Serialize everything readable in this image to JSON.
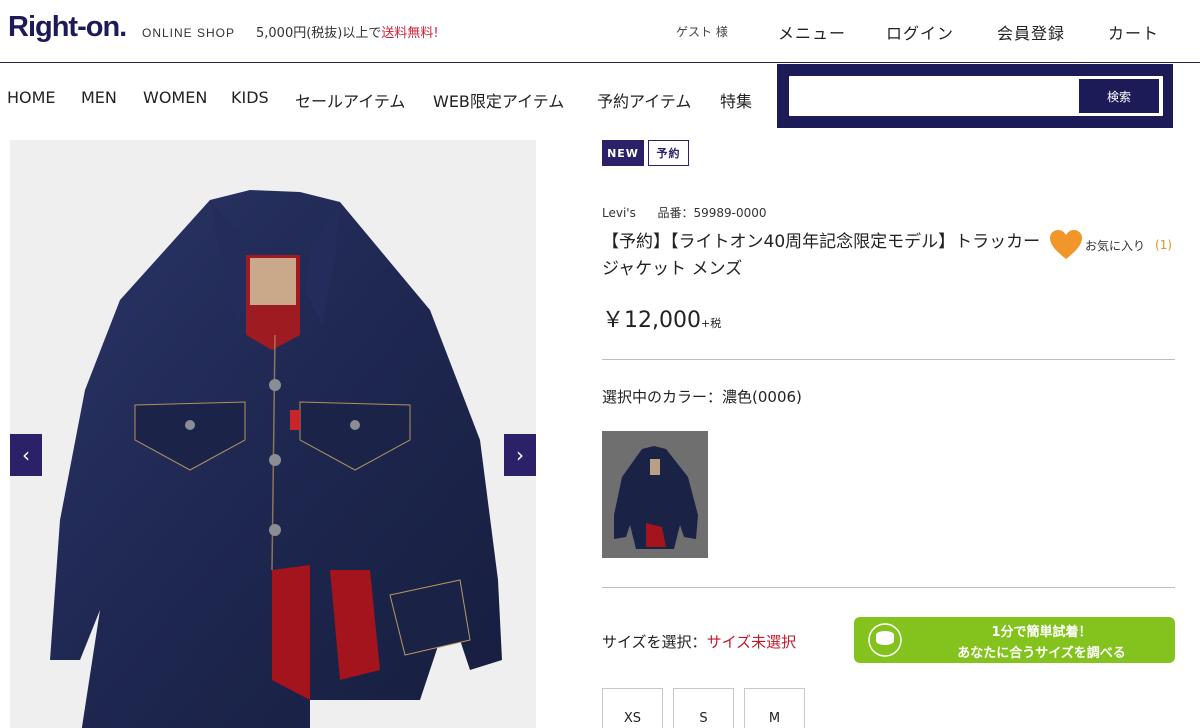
{
  "header": {
    "logo": "Right-on.",
    "logo_sub": "ONLINE SHOP",
    "promo_prefix": "5,000円(税抜)以上で",
    "promo_highlight": "送料無料!",
    "guest": "ゲスト 様",
    "menu": "メニュー",
    "login": "ログイン",
    "register": "会員登録",
    "cart": "カート"
  },
  "nav": {
    "items": [
      "HOME",
      "MEN",
      "WOMEN",
      "KIDS",
      "セールアイテム",
      "WEB限定アイテム",
      "予約アイテム",
      "特集"
    ],
    "search_button": "検索",
    "search_value": ""
  },
  "gallery": {
    "prev_icon": "‹",
    "next_icon": "›"
  },
  "product": {
    "badge_new": "NEW",
    "badge_reserve": "予約",
    "brand": "Levi's",
    "item_number": "品番：59989-0000",
    "title": "【予約】【ライトオン40周年記念限定モデル】トラッカージャケット メンズ",
    "favorite_label": "お気に入り",
    "favorite_count": "(1)",
    "price": "￥12,000",
    "tax": "+税",
    "color_label": "選択中のカラー：濃色(0006)",
    "size_label_prefix": "サイズを選択：",
    "size_label_status": "サイズ未選択",
    "sizes": [
      "XS",
      "S",
      "M"
    ],
    "unisize_line1": "1分で簡単試着！",
    "unisize_line2": "あなたに合うサイズを調べる",
    "unisize_icon_text": "unisize"
  },
  "colors": {
    "brand_navy": "#1d1a58",
    "accent_red": "#c01a2c",
    "fav_orange": "#f0962a",
    "unisize_green": "#84c21d"
  }
}
